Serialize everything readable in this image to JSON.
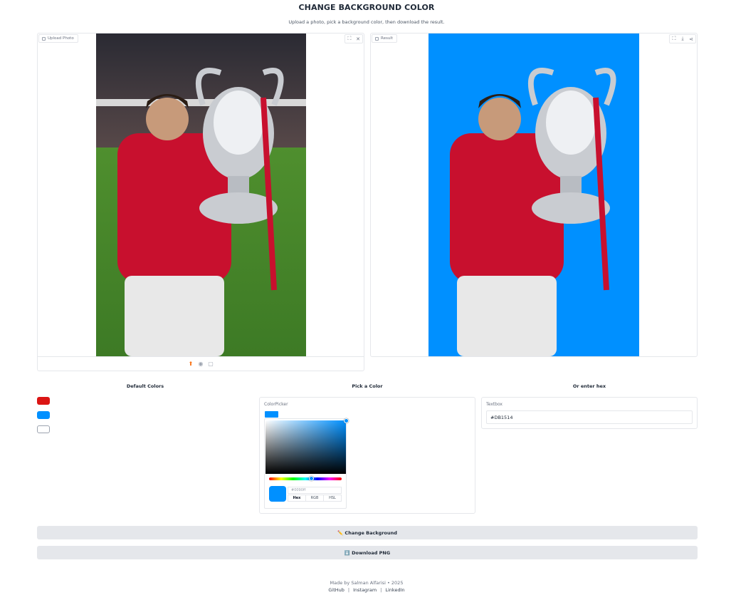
{
  "header": {
    "title": "CHANGE BACKGROUND COLOR",
    "subtitle": "Upload a photo, pick a background color, then download the result."
  },
  "upload_panel": {
    "label": "Upload Photo",
    "tools": [
      "expand-icon",
      "close-icon"
    ],
    "bottom_icons": [
      "upload-icon",
      "webcam-icon",
      "clipboard-icon"
    ]
  },
  "result_panel": {
    "label": "Result",
    "background_color": "#0090ff",
    "tools": [
      "expand-icon",
      "download-icon",
      "share-icon"
    ]
  },
  "default_colors": {
    "heading": "Default Colors",
    "swatches": [
      "#DB1514",
      "#0090FF",
      "#FFFFFF"
    ]
  },
  "color_picker": {
    "heading": "Pick a Color",
    "label": "ColorPicker",
    "value": "#0090ff",
    "hex_text": "#0090ff",
    "modes": [
      "Hex",
      "RGB",
      "HSL"
    ],
    "active_mode": "Hex"
  },
  "hex_input": {
    "heading": "Or enter hex",
    "label": "Textbox",
    "value": "#DB1514"
  },
  "buttons": {
    "change_background": "✏️ Change Background",
    "download_png": "⬇️ Download PNG"
  },
  "footer": {
    "credit": "Made by Salman Alfarisi • 2025",
    "links": [
      "GitHub",
      "Instagram",
      "LinkedIn"
    ],
    "separator": "|"
  },
  "colors": {
    "accent_orange": "#f97316",
    "border": "#e5e7eb",
    "button_bg": "#e5e7eb"
  }
}
